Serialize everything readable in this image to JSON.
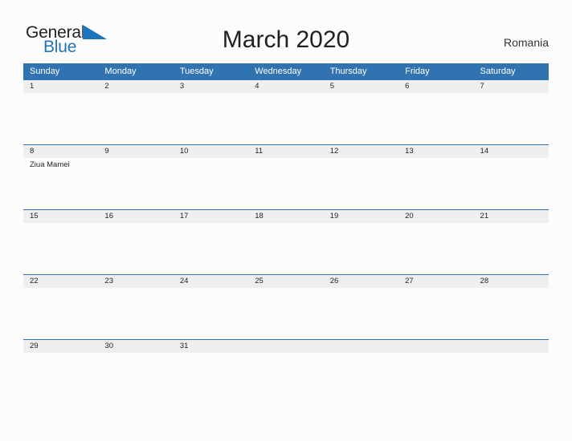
{
  "logo": {
    "word_one": "General",
    "word_two": "Blue",
    "flag_icon": "triangle-flag-icon",
    "colors": {
      "general_text": "#231f20",
      "blue_text": "#1f73b8",
      "flag": "#1f73b8"
    }
  },
  "header": {
    "title": "March 2020",
    "country": "Romania"
  },
  "theme": {
    "header_blue": "#3172b0",
    "date_band_gray": "#efefef",
    "page_background": "#fcfcfc",
    "text_dark": "#231f20"
  },
  "calendar": {
    "month": "March",
    "year": "2020",
    "weekday_headers": [
      "Sunday",
      "Monday",
      "Tuesday",
      "Wednesday",
      "Thursday",
      "Friday",
      "Saturday"
    ],
    "weeks": [
      {
        "days": [
          {
            "num": "1",
            "events": []
          },
          {
            "num": "2",
            "events": []
          },
          {
            "num": "3",
            "events": []
          },
          {
            "num": "4",
            "events": []
          },
          {
            "num": "5",
            "events": []
          },
          {
            "num": "6",
            "events": []
          },
          {
            "num": "7",
            "events": []
          }
        ]
      },
      {
        "days": [
          {
            "num": "8",
            "events": [
              "Ziua Mamei"
            ]
          },
          {
            "num": "9",
            "events": []
          },
          {
            "num": "10",
            "events": []
          },
          {
            "num": "11",
            "events": []
          },
          {
            "num": "12",
            "events": []
          },
          {
            "num": "13",
            "events": []
          },
          {
            "num": "14",
            "events": []
          }
        ]
      },
      {
        "days": [
          {
            "num": "15",
            "events": []
          },
          {
            "num": "16",
            "events": []
          },
          {
            "num": "17",
            "events": []
          },
          {
            "num": "18",
            "events": []
          },
          {
            "num": "19",
            "events": []
          },
          {
            "num": "20",
            "events": []
          },
          {
            "num": "21",
            "events": []
          }
        ]
      },
      {
        "days": [
          {
            "num": "22",
            "events": []
          },
          {
            "num": "23",
            "events": []
          },
          {
            "num": "24",
            "events": []
          },
          {
            "num": "25",
            "events": []
          },
          {
            "num": "26",
            "events": []
          },
          {
            "num": "27",
            "events": []
          },
          {
            "num": "28",
            "events": []
          }
        ]
      },
      {
        "days": [
          {
            "num": "29",
            "events": []
          },
          {
            "num": "30",
            "events": []
          },
          {
            "num": "31",
            "events": []
          },
          {
            "num": "",
            "events": []
          },
          {
            "num": "",
            "events": []
          },
          {
            "num": "",
            "events": []
          },
          {
            "num": "",
            "events": []
          }
        ]
      }
    ]
  }
}
